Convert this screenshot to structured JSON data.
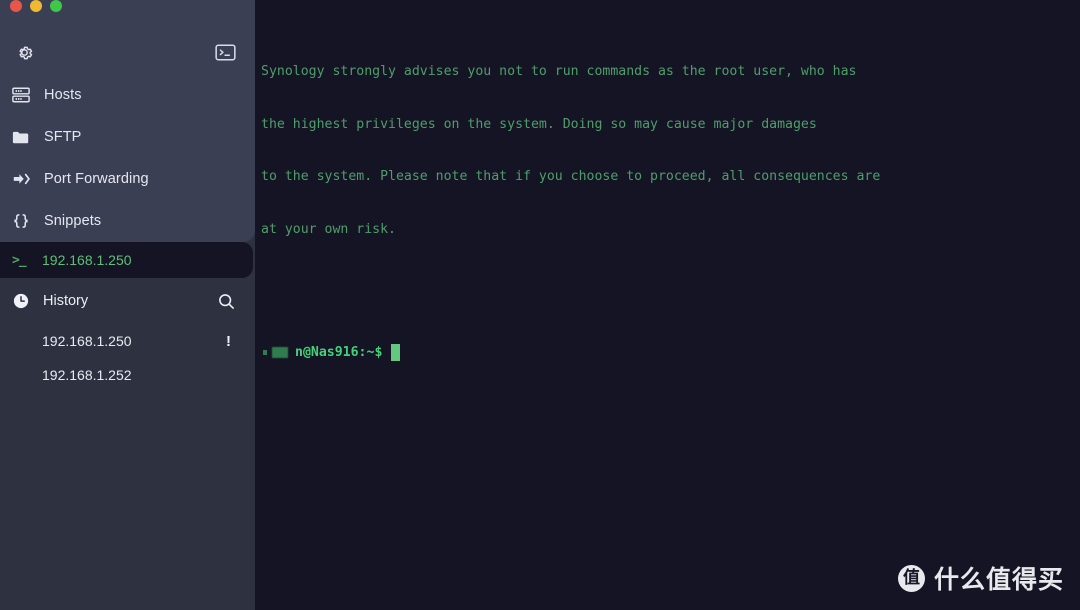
{
  "window": {
    "traffic_lights": [
      {
        "name": "close",
        "color": "#e8564a"
      },
      {
        "name": "minimize",
        "color": "#f0b932"
      },
      {
        "name": "zoom",
        "color": "#3dc84a"
      }
    ]
  },
  "sidebar": {
    "settings_icon": "gear-icon",
    "new_terminal_icon": "terminal-icon",
    "nav": [
      {
        "icon": "server-rack-icon",
        "label": "Hosts"
      },
      {
        "icon": "folder-icon",
        "label": "SFTP"
      },
      {
        "icon": "arrow-right-icon",
        "label": "Port Forwarding"
      },
      {
        "icon": "curly-braces-icon",
        "label": "Snippets"
      }
    ],
    "active_session": {
      "icon": ">_",
      "label": "192.168.1.250",
      "color": "#5fbf78"
    },
    "history": {
      "icon": "clock-icon",
      "title": "History",
      "search_icon": "search-icon",
      "items": [
        {
          "label": "192.168.1.250",
          "badge": "!"
        },
        {
          "label": "192.168.1.252",
          "badge": ""
        }
      ]
    }
  },
  "terminal": {
    "text_color": "#4f9e6a",
    "background": "#141424",
    "lines": [
      "Synology strongly advises you not to run commands as the root user, who has",
      "the highest privileges on the system. Doing so may cause major damages",
      "to the system. Please note that if you choose to proceed, all consequences are",
      "at your own risk."
    ],
    "prompt": {
      "redacted_user": "",
      "user_suffix": "n",
      "at": "@",
      "host": "Nas916",
      "separator": ":",
      "path": "~",
      "sigil": "$",
      "cursor": "block"
    }
  },
  "watermark": {
    "logo_char": "值",
    "text": "什么值得买"
  }
}
